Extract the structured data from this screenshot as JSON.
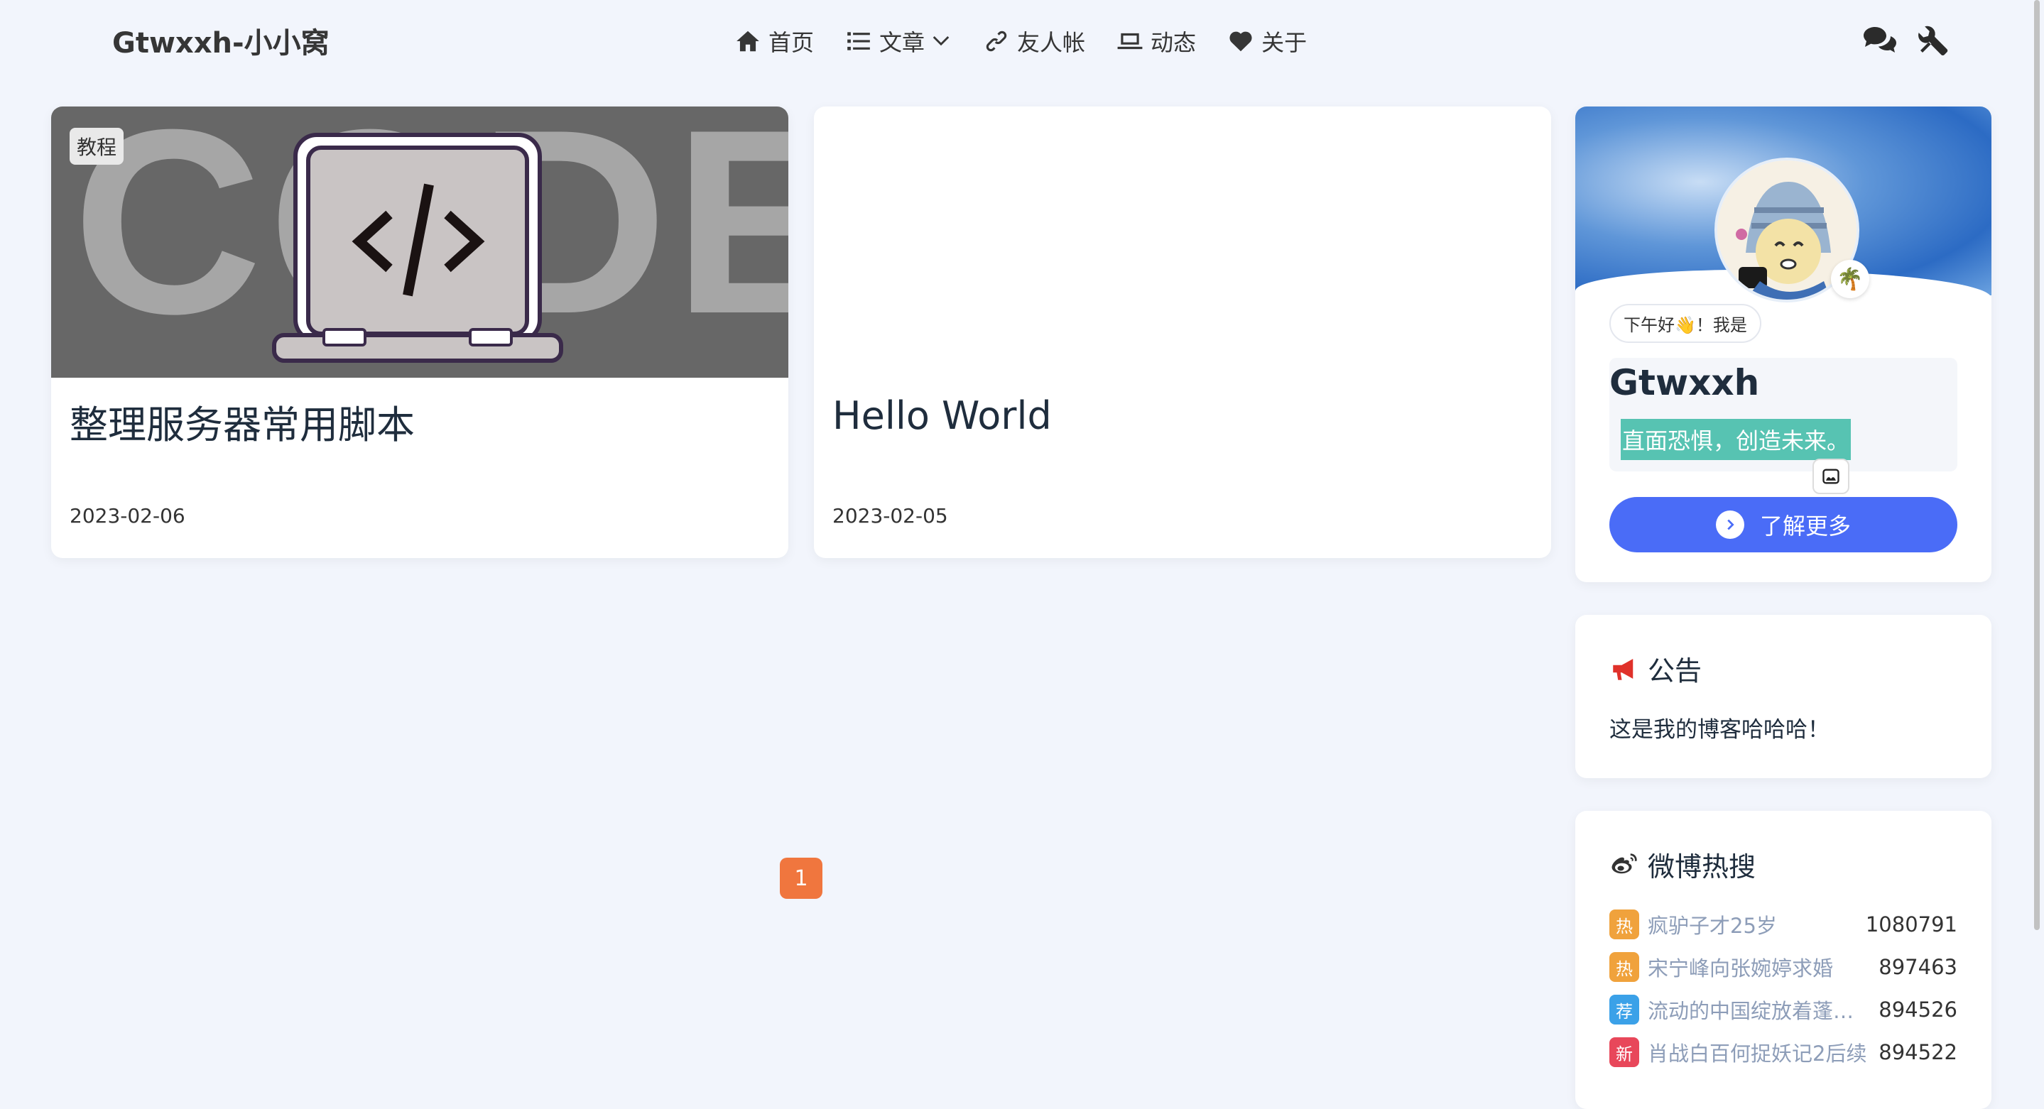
{
  "header": {
    "site_title": "Gtwxxh-小小窝",
    "nav": [
      {
        "label": "首页",
        "icon": "home-icon"
      },
      {
        "label": "文章",
        "icon": "list-icon"
      },
      {
        "label": "友人帐",
        "icon": "link-icon"
      },
      {
        "label": "动态",
        "icon": "laptop-icon"
      },
      {
        "label": "关于",
        "icon": "heart-icon"
      }
    ],
    "tools": [
      "comments-icon",
      "tools-icon"
    ]
  },
  "posts": [
    {
      "tag": "教程",
      "title": "整理服务器常用脚本",
      "date": "2023-02-06",
      "cover_text": "CODE"
    },
    {
      "title": "Hello World",
      "date": "2023-02-05"
    }
  ],
  "pagination": {
    "current": "1"
  },
  "profile": {
    "greeting": "下午好👋！我是",
    "name": "Gtwxxh",
    "motto": "直面恐惧，创造未来。",
    "badge": "🌴",
    "more_label": "了解更多"
  },
  "notice": {
    "title": "公告",
    "text": "这是我的博客哈哈哈！"
  },
  "weibo": {
    "title": "微博热搜",
    "items": [
      {
        "tag": "热",
        "color": "#f0a23c",
        "title": "疯驴子才25岁",
        "count": "1080791"
      },
      {
        "tag": "热",
        "color": "#f0a23c",
        "title": "宋宁峰向张婉婷求婚",
        "count": "897463"
      },
      {
        "tag": "荐",
        "color": "#3ba1e8",
        "title": "流动的中国绽放着蓬勃生机",
        "count": "894526"
      },
      {
        "tag": "新",
        "color": "#e8475a",
        "title": "肖战白百何捉妖记2后续",
        "count": "894522"
      }
    ]
  },
  "colors": {
    "accent": "#4a6cf7",
    "page_active": "#f0763e",
    "motto_bg": "#57c3b2"
  }
}
